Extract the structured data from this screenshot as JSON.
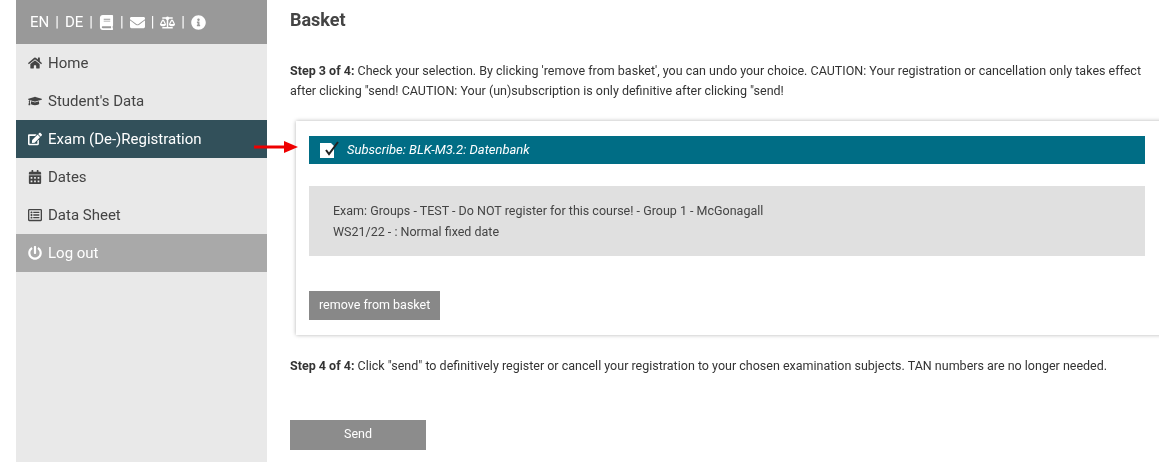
{
  "top_bar": {
    "separator": "|",
    "links": [
      {
        "kind": "text",
        "label": "EN"
      },
      {
        "kind": "text",
        "label": "DE"
      },
      {
        "kind": "book"
      },
      {
        "kind": "mail"
      },
      {
        "kind": "scales"
      },
      {
        "kind": "info"
      }
    ]
  },
  "sidebar": {
    "items": [
      {
        "kind": "home",
        "label": "Home",
        "selected": false
      },
      {
        "kind": "student",
        "label": "Student's Data",
        "selected": false
      },
      {
        "kind": "edit",
        "label": "Exam (De-)Registration",
        "selected": true
      },
      {
        "kind": "calendar",
        "label": "Dates",
        "selected": false
      },
      {
        "kind": "sheet",
        "label": "Data Sheet",
        "selected": false
      },
      {
        "kind": "logout",
        "label": "Log out",
        "selected": false
      }
    ]
  },
  "main": {
    "title": "Basket",
    "step3": {
      "label": "Step 3 of 4:",
      "text": "Check your selection. By clicking 'remove from basket', you can undo your choice. CAUTION: Your registration or cancellation only takes effect after clicking \"send! CAUTION: Your (un)subscription is only definitive after clicking \"send!"
    },
    "basket_item": {
      "title": "Subscribe: BLK-M3.2: Datenbank",
      "lines": [
        "Exam: Groups - TEST - Do NOT register for this course! - Group 1 - McGonagall",
        "WS21/22 - : Normal fixed date"
      ],
      "button": "remove from basket"
    },
    "step4": {
      "label": "Step 4 of 4:",
      "text": "Click \"send\" to definitively register or cancell your registration to your chosen examination subjects. TAN numbers are no longer needed."
    },
    "send_button": "Send"
  }
}
